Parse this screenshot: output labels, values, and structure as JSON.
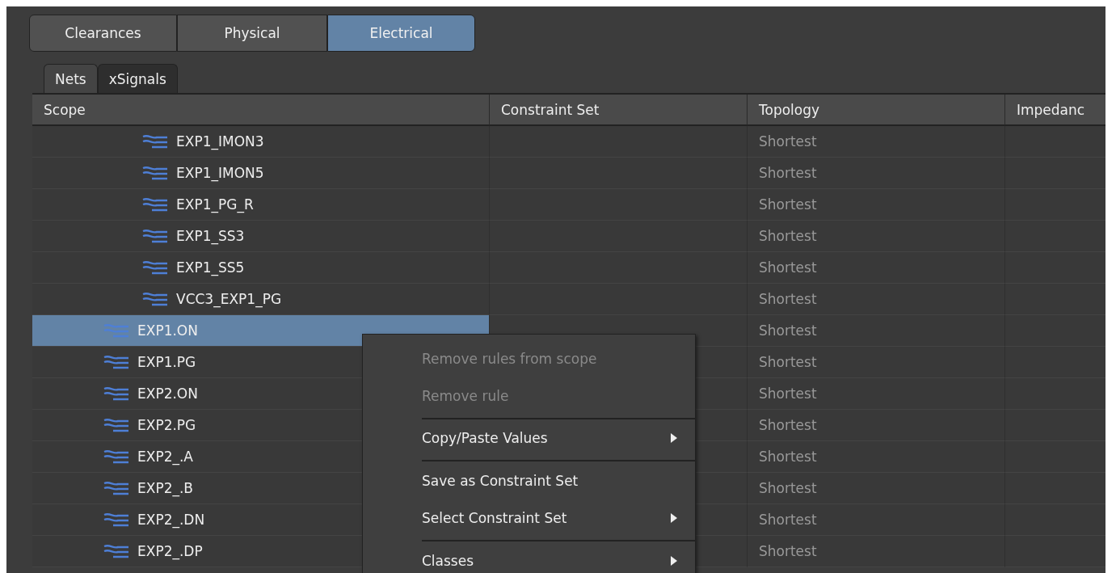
{
  "category_tabs": [
    {
      "label": "Clearances",
      "selected": false
    },
    {
      "label": "Physical",
      "selected": false
    },
    {
      "label": "Electrical",
      "selected": true
    }
  ],
  "sub_tabs": [
    {
      "label": "Nets",
      "selected": true
    },
    {
      "label": "xSignals",
      "selected": false
    }
  ],
  "table": {
    "columns": [
      "Scope",
      "Constraint Set",
      "Topology",
      "Impedanc"
    ],
    "rows": [
      {
        "scope": "EXP1_IMON3",
        "kind": "member",
        "topology": "Shortest",
        "selected": false
      },
      {
        "scope": "EXP1_IMON5",
        "kind": "member",
        "topology": "Shortest",
        "selected": false
      },
      {
        "scope": "EXP1_PG_R",
        "kind": "member",
        "topology": "Shortest",
        "selected": false
      },
      {
        "scope": "EXP1_SS3",
        "kind": "member",
        "topology": "Shortest",
        "selected": false
      },
      {
        "scope": "EXP1_SS5",
        "kind": "member",
        "topology": "Shortest",
        "selected": false
      },
      {
        "scope": "VCC3_EXP1_PG",
        "kind": "member",
        "topology": "Shortest",
        "selected": false
      },
      {
        "scope": "EXP1.ON",
        "kind": "net",
        "topology": "Shortest",
        "selected": true
      },
      {
        "scope": "EXP1.PG",
        "kind": "net",
        "topology": "Shortest",
        "selected": false
      },
      {
        "scope": "EXP2.ON",
        "kind": "net",
        "topology": "Shortest",
        "selected": false
      },
      {
        "scope": "EXP2.PG",
        "kind": "net",
        "topology": "Shortest",
        "selected": false
      },
      {
        "scope": "EXP2_.A",
        "kind": "net",
        "topology": "Shortest",
        "selected": false
      },
      {
        "scope": "EXP2_.B",
        "kind": "net",
        "topology": "Shortest",
        "selected": false
      },
      {
        "scope": "EXP2_.DN",
        "kind": "net",
        "topology": "Shortest",
        "selected": false
      },
      {
        "scope": "EXP2_.DP",
        "kind": "net",
        "topology": "Shortest",
        "selected": false
      }
    ]
  },
  "context_menu": [
    {
      "label": "Remove rules from scope",
      "disabled": true,
      "submenu": false,
      "separator_after": false
    },
    {
      "label": "Remove rule",
      "disabled": true,
      "submenu": false,
      "separator_after": true
    },
    {
      "label": "Copy/Paste Values",
      "disabled": false,
      "submenu": true,
      "separator_after": true
    },
    {
      "label": "Save as Constraint Set",
      "disabled": false,
      "submenu": false,
      "separator_after": false
    },
    {
      "label": "Select Constraint Set",
      "disabled": false,
      "submenu": true,
      "separator_after": true
    },
    {
      "label": "Classes",
      "disabled": false,
      "submenu": true,
      "separator_after": false
    }
  ]
}
